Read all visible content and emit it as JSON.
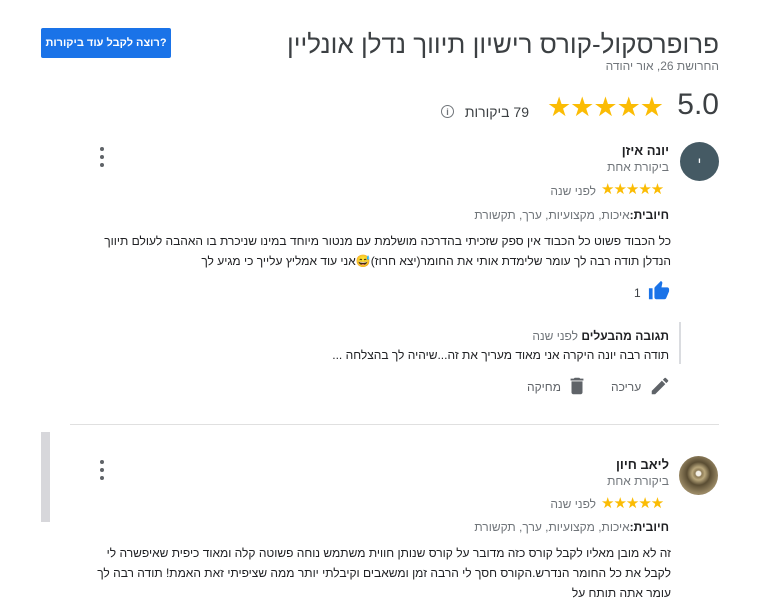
{
  "header": {
    "more_reviews_button": "רוצה לקבל עוד ביקורות?",
    "business_name": "פרופרסקול-קורס רישיון תיווך נדלן אונליין",
    "address": "החרושת 26, אור יהודה",
    "rating_score": "5.0",
    "rating_stars": "★★★★★",
    "rating_value": 5,
    "reviews_count": "79 ביקורות",
    "info_icon": "i"
  },
  "reviews": [
    {
      "avatar_letter": "י",
      "name": "יונה איזן",
      "reviewer_stats": "ביקורת אחת",
      "stars": "★★★★★",
      "rating_value": 5,
      "time": "לפני שנה",
      "positives_label": "חיובית:",
      "positives": "איכות, מקצועיות, ערך, תקשורת",
      "text": "כל הכבוד פשוט כל הכבוד אין ספק שזכיתי בהדרכה מושלמת עם מנטור מיוחד במינו שניכרת בו האהבה לעולם תיווך הנדלן תודה רבה לך עומר שלימדת אותי את החומר(יצא חרוז)😅אני עוד אמליץ עלייך כי מגיע לך",
      "likes": "1",
      "reply": {
        "author": "תגובה מהבעלים",
        "time": "לפני שנה",
        "text": "תודה רבה יונה היקרה אני מאוד מעריך את זה...שיהיה לך בהצלחה ..."
      },
      "actions": {
        "edit": "עריכה",
        "delete": "מחיקה"
      }
    },
    {
      "name": "ליאב חיון",
      "reviewer_stats": "ביקורת אחת",
      "stars": "★★★★★",
      "rating_value": 5,
      "time": "לפני שנה",
      "positives_label": "חיובית:",
      "positives": "איכות, מקצועיות, ערך, תקשורת",
      "text": "זה לא מובן מאליו לקבל קורס כזה מדובר על קורס שנותן חווית משתמש נוחה פשוטה קלה ומאוד כיפית שאיפשרה לי לקבל את כל החומר הנדרש.הקורס חסך לי הרבה זמן ומשאבים וקיבלתי יותר ממה שציפיתי זאת האמת! תודה רבה לך עומר אתה תותח על"
    }
  ],
  "colors": {
    "accent": "#1a73e8",
    "star": "#fbbc04",
    "avatar1": "#455a64"
  },
  "icons": [
    "info-icon",
    "more-vert-icon",
    "thumbs-up-icon",
    "pencil-icon",
    "trash-icon"
  ]
}
